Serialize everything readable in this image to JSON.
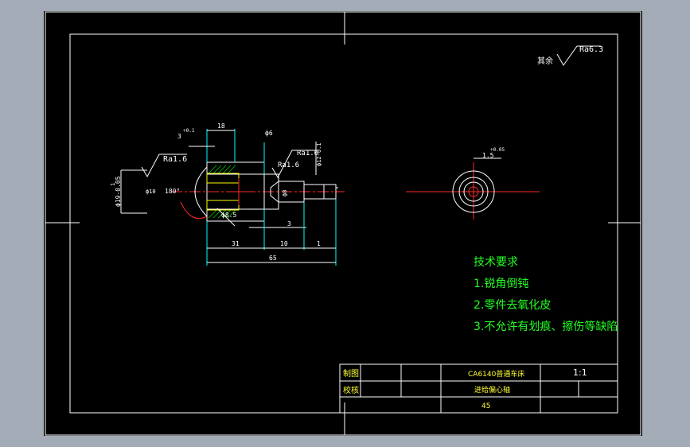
{
  "surface_roughness": {
    "other_label": "其余",
    "other_value": "Ra6.3",
    "ra1": "Ra1.6",
    "ra2": "Ra1.6"
  },
  "dimensions": {
    "top_18": "18",
    "top_tol": "3",
    "top_tol_sup": "+0.1",
    "dia_6": "ф6",
    "left_dia": "ф19-0.05",
    "left_small": "1",
    "angle": "180°",
    "bore": "ф10",
    "dia_85": "ф8.5",
    "slot": "3",
    "len_31": "31",
    "len_10": "10",
    "len_1": "1",
    "len_65": "65",
    "right_tol": "ф12-0.1",
    "right_dia": "ф8",
    "side_view_dim": "1.5",
    "side_view_sup": "+0.05"
  },
  "tech_requirements": {
    "title": "技术要求",
    "items": [
      "1.锐角倒钝",
      "2.零件去氧化皮",
      "3.不允许有划痕、擦伤等缺陷"
    ]
  },
  "title_block": {
    "drawn_label": "制图",
    "checked_label": "校核",
    "part_title_line1": "CA6140普通车床",
    "part_title_line2": "进给偏心轴",
    "scale": "1:1",
    "material": "45"
  }
}
